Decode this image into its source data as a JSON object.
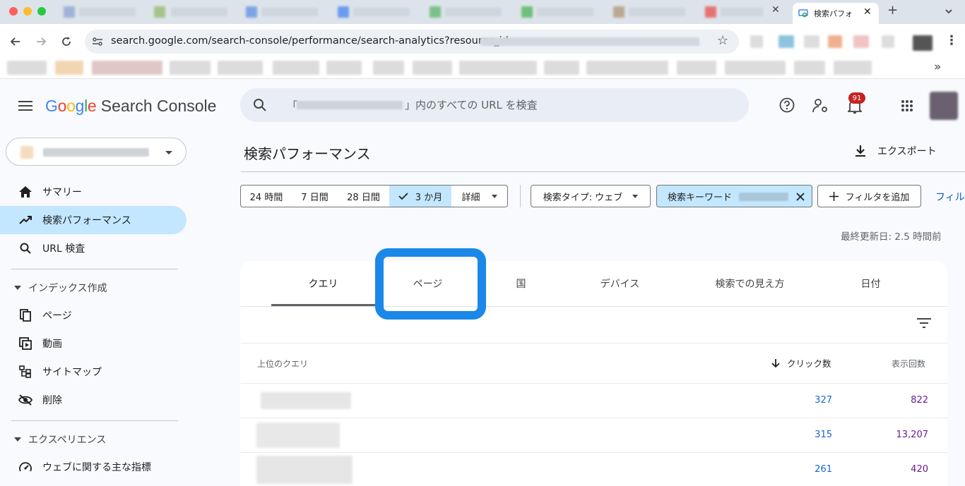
{
  "browser": {
    "active_tab_title": "検索パフォ",
    "address": "search.google.com/search-console/performance/search-analytics?resource_id="
  },
  "header": {
    "product_google": "Google",
    "product_name": "Search Console",
    "search_placeholder_suffix": "」内のすべての URL を検査",
    "search_placeholder_prefix": "「",
    "notification_count": "91"
  },
  "sidebar": {
    "items": [
      {
        "label": "サマリー",
        "icon": "home-icon"
      },
      {
        "label": "検索パフォーマンス",
        "icon": "trending-up-icon"
      },
      {
        "label": "URL 検査",
        "icon": "search-icon"
      }
    ],
    "index_section": "インデックス作成",
    "index_items": [
      {
        "label": "ページ",
        "icon": "pages-icon"
      },
      {
        "label": "動画",
        "icon": "video-icon"
      },
      {
        "label": "サイトマップ",
        "icon": "sitemap-icon"
      },
      {
        "label": "削除",
        "icon": "remove-visibility-icon"
      }
    ],
    "experience_section": "エクスペリエンス",
    "experience_items": [
      {
        "label": "ウェブに関する主な指標",
        "icon": "gauge-icon"
      }
    ]
  },
  "main": {
    "page_title": "検索パフォーマンス",
    "export_label": "エクスポート",
    "date_chips": [
      "24 時間",
      "7 日間",
      "28 日間",
      "3 か月",
      "詳細"
    ],
    "selected_date_chip": "3 か月",
    "search_type_label": "検索タイプ: ウェブ",
    "keyword_filter_label": "検索キーワード",
    "add_filter_label": "フィルタを追加",
    "overflow_label": "フィル",
    "last_updated": "最終更新日: 2.5 時間前",
    "tabs": [
      "クエリ",
      "ページ",
      "国",
      "デバイス",
      "検索での見え方",
      "日付"
    ],
    "table": {
      "col_query": "上位のクエリ",
      "col_clicks": "クリック数",
      "col_impressions": "表示回数",
      "rows": [
        {
          "clicks": "327",
          "impressions": "822"
        },
        {
          "clicks": "315",
          "impressions": "13,207"
        },
        {
          "clicks": "261",
          "impressions": "420"
        }
      ]
    }
  },
  "colors": {
    "accent_blue": "#0b57d0",
    "selected_chip": "#c2e7ff",
    "highlight_box": "#1a88e8",
    "clicks_color": "#1967d2",
    "impressions_color": "#6a1b9a"
  }
}
